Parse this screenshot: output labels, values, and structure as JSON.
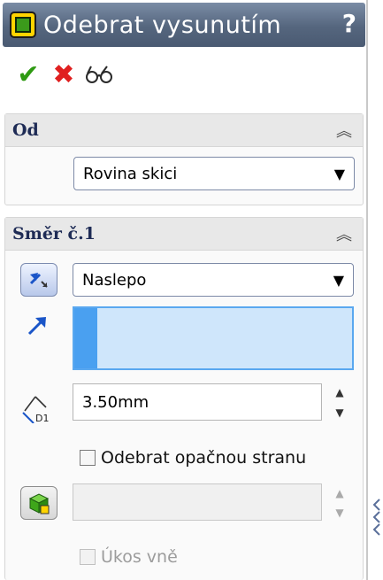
{
  "window": {
    "title": "Odebrat vysunutím",
    "help": "?"
  },
  "actions": {
    "ok_icon": "check-icon",
    "cancel_icon": "close-icon",
    "preview_icon": "glasses-icon"
  },
  "from_group": {
    "title": "Od",
    "select_value": "Rovina skici"
  },
  "direction_group": {
    "title": "Směr č.1",
    "end_condition": "Naslepo",
    "depth_value": "3.50mm",
    "depth_icon_label": "D1",
    "flip_side_label": "Odebrat opačnou stranu",
    "draft_label": "Úkos vně"
  },
  "colors": {
    "title_bar": "#55667e",
    "accent": "#4aa0f0",
    "ok": "#2e9a12",
    "cancel": "#e02020"
  }
}
